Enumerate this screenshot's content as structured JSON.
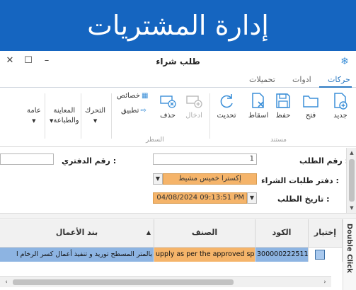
{
  "banner": {
    "title": "إدارة المشتريات"
  },
  "window": {
    "title": "طلب شراء",
    "minimize": "–",
    "maximize": "☐",
    "close": "✕"
  },
  "tabs": [
    {
      "label": "حركات",
      "active": true
    },
    {
      "label": "ادوات"
    },
    {
      "label": "تحميلات"
    }
  ],
  "ribbon": {
    "new": "جديد",
    "open": "فتح",
    "save": "حفظ",
    "drop": "اسقاط",
    "refresh": "تحديث",
    "document_group": "مستند",
    "insert": "ادخال",
    "delete": "حذف",
    "properties": "خصائص",
    "apply": "تطبيق",
    "line_group": "السطر",
    "move": "التحرك",
    "preview_print_1": "المعاينة",
    "preview_print_2": "والطباعة",
    "general": "عامة"
  },
  "form": {
    "request_no_label": "رقم الطلب :",
    "request_no_value": "1",
    "book_no_label": "رقم الدفتري :",
    "book_no_value": "",
    "book_label": "دفتر طلبات الشراء :",
    "book_value": "إكسترا خميس مشيط",
    "date_label": "تاريخ الطلب :",
    "date_value": "04/08/2024 09:13:51 PM"
  },
  "grid": {
    "headers": {
      "select": "إختيار",
      "code": "الكود",
      "item": "الصنف",
      "work_item": "بند الأعمال"
    },
    "rows": [
      {
        "code": "300000222511",
        "item": "upply as per the approved specs",
        "work_item": "بالمتر المسطح توريد و تنفيذ أعمال كسر الرخام ا"
      }
    ],
    "side_tab": "Double Click"
  }
}
